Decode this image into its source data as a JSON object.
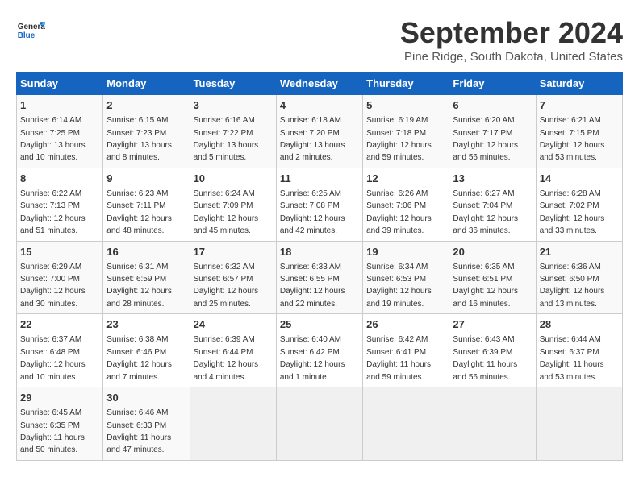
{
  "header": {
    "logo_general": "General",
    "logo_blue": "Blue",
    "month_title": "September 2024",
    "location": "Pine Ridge, South Dakota, United States"
  },
  "days_of_week": [
    "Sunday",
    "Monday",
    "Tuesday",
    "Wednesday",
    "Thursday",
    "Friday",
    "Saturday"
  ],
  "weeks": [
    [
      {
        "day": "1",
        "sunrise": "6:14 AM",
        "sunset": "7:25 PM",
        "daylight": "13 hours and 10 minutes."
      },
      {
        "day": "2",
        "sunrise": "6:15 AM",
        "sunset": "7:23 PM",
        "daylight": "13 hours and 8 minutes."
      },
      {
        "day": "3",
        "sunrise": "6:16 AM",
        "sunset": "7:22 PM",
        "daylight": "13 hours and 5 minutes."
      },
      {
        "day": "4",
        "sunrise": "6:18 AM",
        "sunset": "7:20 PM",
        "daylight": "13 hours and 2 minutes."
      },
      {
        "day": "5",
        "sunrise": "6:19 AM",
        "sunset": "7:18 PM",
        "daylight": "12 hours and 59 minutes."
      },
      {
        "day": "6",
        "sunrise": "6:20 AM",
        "sunset": "7:17 PM",
        "daylight": "12 hours and 56 minutes."
      },
      {
        "day": "7",
        "sunrise": "6:21 AM",
        "sunset": "7:15 PM",
        "daylight": "12 hours and 53 minutes."
      }
    ],
    [
      {
        "day": "8",
        "sunrise": "6:22 AM",
        "sunset": "7:13 PM",
        "daylight": "12 hours and 51 minutes."
      },
      {
        "day": "9",
        "sunrise": "6:23 AM",
        "sunset": "7:11 PM",
        "daylight": "12 hours and 48 minutes."
      },
      {
        "day": "10",
        "sunrise": "6:24 AM",
        "sunset": "7:09 PM",
        "daylight": "12 hours and 45 minutes."
      },
      {
        "day": "11",
        "sunrise": "6:25 AM",
        "sunset": "7:08 PM",
        "daylight": "12 hours and 42 minutes."
      },
      {
        "day": "12",
        "sunrise": "6:26 AM",
        "sunset": "7:06 PM",
        "daylight": "12 hours and 39 minutes."
      },
      {
        "day": "13",
        "sunrise": "6:27 AM",
        "sunset": "7:04 PM",
        "daylight": "12 hours and 36 minutes."
      },
      {
        "day": "14",
        "sunrise": "6:28 AM",
        "sunset": "7:02 PM",
        "daylight": "12 hours and 33 minutes."
      }
    ],
    [
      {
        "day": "15",
        "sunrise": "6:29 AM",
        "sunset": "7:00 PM",
        "daylight": "12 hours and 30 minutes."
      },
      {
        "day": "16",
        "sunrise": "6:31 AM",
        "sunset": "6:59 PM",
        "daylight": "12 hours and 28 minutes."
      },
      {
        "day": "17",
        "sunrise": "6:32 AM",
        "sunset": "6:57 PM",
        "daylight": "12 hours and 25 minutes."
      },
      {
        "day": "18",
        "sunrise": "6:33 AM",
        "sunset": "6:55 PM",
        "daylight": "12 hours and 22 minutes."
      },
      {
        "day": "19",
        "sunrise": "6:34 AM",
        "sunset": "6:53 PM",
        "daylight": "12 hours and 19 minutes."
      },
      {
        "day": "20",
        "sunrise": "6:35 AM",
        "sunset": "6:51 PM",
        "daylight": "12 hours and 16 minutes."
      },
      {
        "day": "21",
        "sunrise": "6:36 AM",
        "sunset": "6:50 PM",
        "daylight": "12 hours and 13 minutes."
      }
    ],
    [
      {
        "day": "22",
        "sunrise": "6:37 AM",
        "sunset": "6:48 PM",
        "daylight": "12 hours and 10 minutes."
      },
      {
        "day": "23",
        "sunrise": "6:38 AM",
        "sunset": "6:46 PM",
        "daylight": "12 hours and 7 minutes."
      },
      {
        "day": "24",
        "sunrise": "6:39 AM",
        "sunset": "6:44 PM",
        "daylight": "12 hours and 4 minutes."
      },
      {
        "day": "25",
        "sunrise": "6:40 AM",
        "sunset": "6:42 PM",
        "daylight": "12 hours and 1 minute."
      },
      {
        "day": "26",
        "sunrise": "6:42 AM",
        "sunset": "6:41 PM",
        "daylight": "11 hours and 59 minutes."
      },
      {
        "day": "27",
        "sunrise": "6:43 AM",
        "sunset": "6:39 PM",
        "daylight": "11 hours and 56 minutes."
      },
      {
        "day": "28",
        "sunrise": "6:44 AM",
        "sunset": "6:37 PM",
        "daylight": "11 hours and 53 minutes."
      }
    ],
    [
      {
        "day": "29",
        "sunrise": "6:45 AM",
        "sunset": "6:35 PM",
        "daylight": "11 hours and 50 minutes."
      },
      {
        "day": "30",
        "sunrise": "6:46 AM",
        "sunset": "6:33 PM",
        "daylight": "11 hours and 47 minutes."
      },
      null,
      null,
      null,
      null,
      null
    ]
  ]
}
